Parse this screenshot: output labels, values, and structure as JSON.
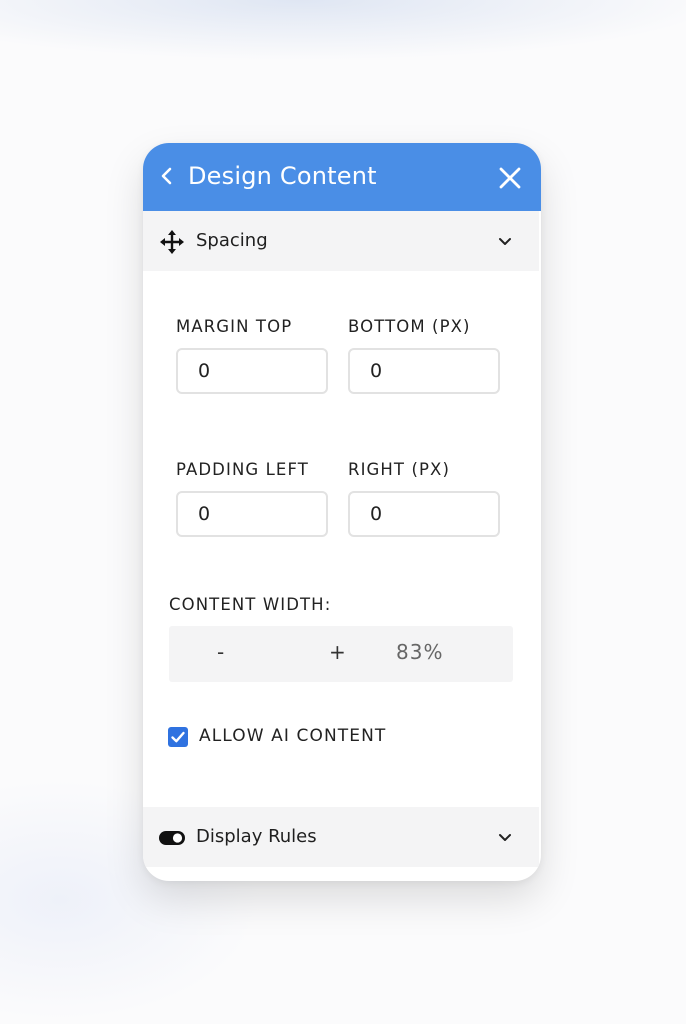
{
  "header": {
    "title": "Design Content",
    "back_icon": "chevron-left-icon",
    "close_icon": "close-icon",
    "color": "#4a8ee6"
  },
  "spacing_section": {
    "label": "Spacing",
    "icon": "move-arrows-icon",
    "margin": {
      "top_label": "MARGIN TOP",
      "bottom_label": "BOTTOM (PX)",
      "top_value": "0",
      "bottom_value": "0"
    },
    "padding": {
      "left_label": "PADDING LEFT",
      "right_label": "RIGHT (PX)",
      "left_value": "0",
      "right_value": "0"
    },
    "content_width": {
      "label": "CONTENT WIDTH:",
      "decrease": "-",
      "increase": "+",
      "value": "83%"
    },
    "allow_ai": {
      "label": "ALLOW AI CONTENT",
      "checked": true,
      "color": "#2f72e0"
    }
  },
  "display_rules_section": {
    "label": "Display Rules",
    "icon": "toggle-icon"
  }
}
